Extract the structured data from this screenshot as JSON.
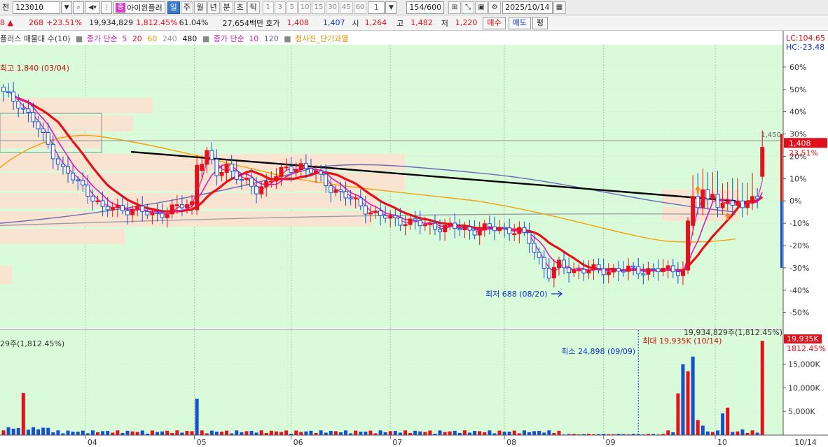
{
  "toolbar": {
    "label_prefix": "전",
    "stock_code": "123010",
    "stock_type_badge": "종",
    "stock_name": "아이윈플러",
    "periods": [
      "일",
      "주",
      "월",
      "년",
      "분",
      "초",
      "틱"
    ],
    "active_period": "일",
    "interval_buttons": [
      "1",
      "3",
      "5",
      "10",
      "15",
      "30",
      "45",
      "60"
    ],
    "interval_value": "1",
    "count_text": "154",
    "count_total": "/600",
    "date": "2025/10/14",
    "icons": [
      "speaker-icon",
      "split-icon",
      "chart-compare-icon",
      "save-icon",
      "gear-icon",
      "calendar-icon"
    ]
  },
  "quote": {
    "prev_change_prefix": "8 ▲",
    "change": "268",
    "change_pct": "+23.51%",
    "volume": "19,934,829",
    "volume_ratio": "1,812.45%",
    "turnover_ratio": "61.04%",
    "amount": "27,654백만",
    "hoga_label": "호가",
    "ask": "1,408",
    "bid": "1,407",
    "open_label": "시",
    "open": "1,264",
    "high_label": "고",
    "high": "1,482",
    "low_label": "저",
    "low": "1,220",
    "buy_label": "매수",
    "sell_label": "매도",
    "eval_label": "평"
  },
  "legend": {
    "volume_profile": "플러스 매물대 수(10)",
    "ma_group1_label": "종가 단순",
    "ma_group1_periods": [
      "5",
      "20",
      "60",
      "240",
      "480"
    ],
    "ma_group2_label": "종가 단순",
    "ma_group2_periods": [
      "10",
      "120"
    ],
    "signal": "청사진_단기과열"
  },
  "colors": {
    "bg_price": "#d9fbd9",
    "bg_volume": "#d9fbd9",
    "up": "#e8101a",
    "down": "#1550d0",
    "ma5": "#e21ab8",
    "ma10": "#e21ab8",
    "ma20": "#e8101a",
    "ma60": "#f2a20a",
    "ma120": "#6a6ab8",
    "ma240": "#9a9aa8",
    "ma480": "#000000",
    "volume_profile": "#f8e4d0"
  },
  "chart_data": {
    "type": "candlestick",
    "symbol": "아이윈플러",
    "x_ticks": [
      "04",
      "05",
      "06",
      "07",
      "08",
      "09",
      "10",
      "10/14"
    ],
    "y_ticks_pct": [
      "60%",
      "50%",
      "40%",
      "30%",
      "20%",
      "10%",
      "0%",
      "-10%",
      "-20%",
      "-30%",
      "-40%",
      "-50%"
    ],
    "reference_line": "1,450",
    "current_price": "1,408",
    "current_change": "23.51%",
    "lc_label": "LC:104.65",
    "hc_label": "HC:-23.48",
    "annotations": {
      "high": "최고 1,840 (03/04)",
      "low": "최저 688 (08/20)"
    },
    "volume": {
      "y_ticks": [
        "15,000K",
        "10,000K",
        "5,000K"
      ],
      "left_label": "29주(1,812.45%)",
      "top_right_label": "19,934,829주(1,812.45%)",
      "current_badge": "19,935K",
      "current_pct": "1812.45%",
      "min_annotation": "최소 24,898 (09/09)",
      "max_annotation": "최대 19,935K (10/14)",
      "max": 19935,
      "min": 24.898
    },
    "ma_periods": [
      5,
      10,
      20,
      60,
      120,
      240,
      480
    ]
  }
}
